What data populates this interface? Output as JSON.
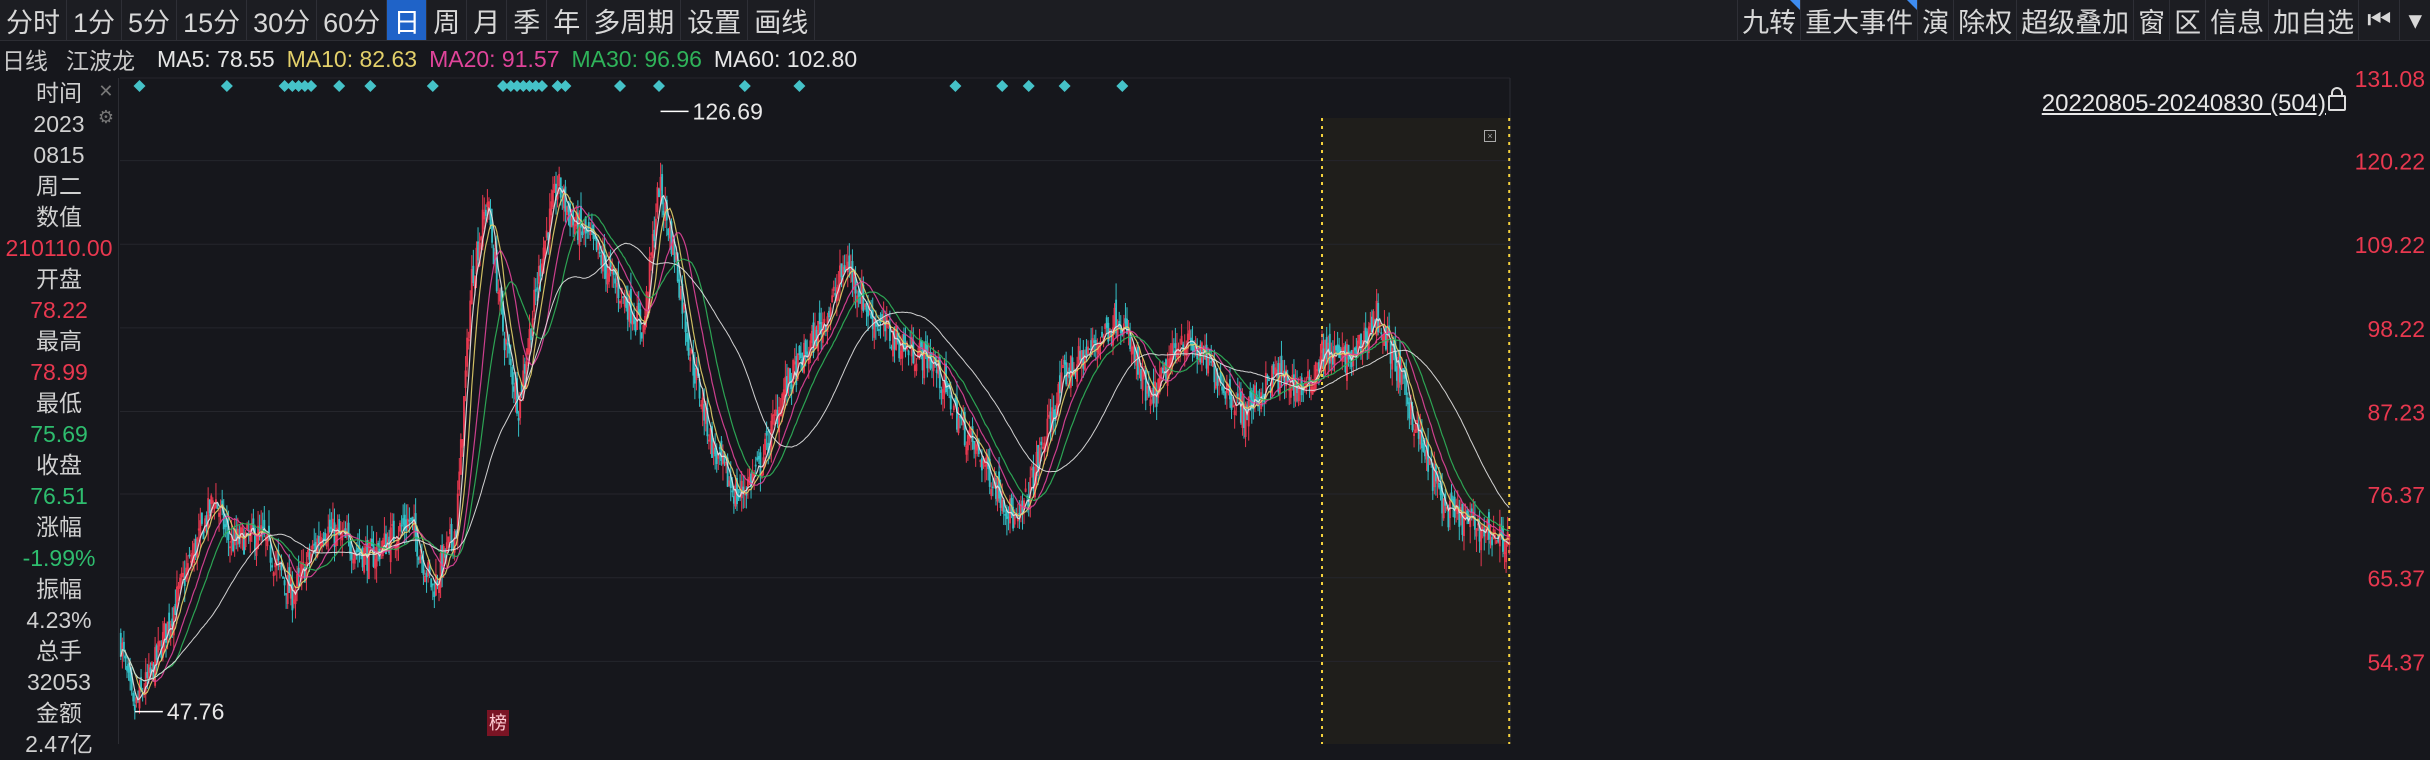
{
  "toolbar": {
    "timeframes": [
      "分时",
      "1分",
      "5分",
      "15分",
      "30分",
      "60分",
      "日",
      "周",
      "月",
      "季",
      "年",
      "多周期",
      "设置",
      "画线"
    ],
    "active_index": 6,
    "right_items": [
      "九转",
      "重大事件",
      "演",
      "除权",
      "超级叠加",
      "窗",
      "区",
      "信息",
      "加自选"
    ]
  },
  "ma_legend": {
    "period": "日线",
    "name": "江波龙",
    "items": [
      {
        "label": "MA5: 78.55",
        "color": "#e6e6e6"
      },
      {
        "label": "MA10: 82.63",
        "color": "#e3d06a"
      },
      {
        "label": "MA20: 91.57",
        "color": "#e0449a"
      },
      {
        "label": "MA30: 96.96",
        "color": "#2fb35a"
      },
      {
        "label": "MA60: 102.80",
        "color": "#e6e6e6"
      }
    ]
  },
  "info_panel": [
    {
      "text": "时间",
      "style": "label"
    },
    {
      "text": "2023",
      "style": "white"
    },
    {
      "text": "0815",
      "style": "white"
    },
    {
      "text": "周二",
      "style": "white"
    },
    {
      "text": "数值",
      "style": "label"
    },
    {
      "text": "210110.00",
      "style": "red"
    },
    {
      "text": "开盘",
      "style": "label"
    },
    {
      "text": "78.22",
      "style": "red"
    },
    {
      "text": "最高",
      "style": "label"
    },
    {
      "text": "78.99",
      "style": "red"
    },
    {
      "text": "最低",
      "style": "label"
    },
    {
      "text": "75.69",
      "style": "green"
    },
    {
      "text": "收盘",
      "style": "label"
    },
    {
      "text": "76.51",
      "style": "green"
    },
    {
      "text": "涨幅",
      "style": "label"
    },
    {
      "text": "-1.99%",
      "style": "green"
    },
    {
      "text": "振幅",
      "style": "label"
    },
    {
      "text": "4.23%",
      "style": "white"
    },
    {
      "text": "总手",
      "style": "label"
    },
    {
      "text": "32053",
      "style": "white"
    },
    {
      "text": "金额",
      "style": "label"
    },
    {
      "text": "2.47亿",
      "style": "white"
    }
  ],
  "range_label": "20220805-20240830 (504)",
  "badge": "榜",
  "chart_data": {
    "type": "candlestick",
    "ylim": [
      43.5,
      131.08
    ],
    "y_ticks": [
      131.08,
      120.22,
      109.22,
      98.22,
      87.23,
      76.37,
      65.37,
      54.37
    ],
    "max_label": "126.69",
    "min_label": "47.76",
    "max_value": 126.69,
    "min_value": 47.76,
    "closes_hint": "approximate daily price path",
    "anchors": [
      [
        0,
        57
      ],
      [
        8,
        47.8
      ],
      [
        20,
        53
      ],
      [
        40,
        65
      ],
      [
        60,
        76
      ],
      [
        70,
        70
      ],
      [
        90,
        71
      ],
      [
        110,
        63
      ],
      [
        130,
        72
      ],
      [
        160,
        68
      ],
      [
        185,
        73
      ],
      [
        200,
        64
      ],
      [
        215,
        72
      ],
      [
        225,
        105
      ],
      [
        235,
        115
      ],
      [
        245,
        98
      ],
      [
        255,
        88
      ],
      [
        270,
        108
      ],
      [
        280,
        117
      ],
      [
        290,
        112
      ],
      [
        300,
        110
      ],
      [
        320,
        103
      ],
      [
        335,
        98
      ],
      [
        345,
        117
      ],
      [
        355,
        108
      ],
      [
        365,
        95
      ],
      [
        380,
        82
      ],
      [
        395,
        76
      ],
      [
        410,
        80
      ],
      [
        425,
        90
      ],
      [
        440,
        95
      ],
      [
        455,
        101
      ],
      [
        465,
        107
      ],
      [
        480,
        100
      ],
      [
        500,
        96
      ],
      [
        520,
        94
      ],
      [
        540,
        85
      ],
      [
        560,
        78
      ],
      [
        575,
        72
      ],
      [
        590,
        82
      ],
      [
        605,
        92
      ],
      [
        620,
        95
      ],
      [
        640,
        100
      ],
      [
        660,
        88
      ],
      [
        680,
        97
      ],
      [
        700,
        93
      ],
      [
        720,
        87
      ],
      [
        740,
        92
      ],
      [
        760,
        90
      ],
      [
        770,
        95
      ],
      [
        790,
        94
      ],
      [
        805,
        100
      ],
      [
        820,
        92
      ],
      [
        835,
        82
      ],
      [
        850,
        74
      ],
      [
        870,
        72
      ],
      [
        890,
        70
      ]
    ],
    "highlight_range_days": [
      770,
      890
    ]
  }
}
